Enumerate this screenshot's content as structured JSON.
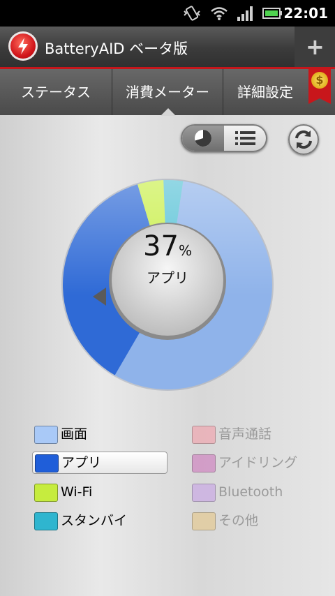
{
  "status_bar": {
    "time": "22:01",
    "icons": [
      "vibrate-icon",
      "wifi-icon",
      "signal-icon",
      "battery-icon"
    ]
  },
  "app_bar": {
    "title": "BatteryAID ベータ版",
    "logo_icon": "batteryaid-logo-icon",
    "add_icon": "plus-icon",
    "add_label": "+"
  },
  "tabs": [
    {
      "label": "ステータス",
      "selected": false
    },
    {
      "label": "消費メーター",
      "selected": true
    },
    {
      "label": "詳細設定",
      "selected": false
    }
  ],
  "premium_badge": {
    "icon": "dollar-coin-icon",
    "label": "$"
  },
  "view_toggle": {
    "options": [
      "pie-chart-icon",
      "list-icon"
    ],
    "selected": "pie-chart-icon"
  },
  "refresh_icon": "refresh-icon",
  "meter": {
    "selected_percent": "37",
    "percent_sign": "%",
    "selected_name": "アプリ"
  },
  "chart_data": {
    "type": "pie",
    "categories": [
      "画面",
      "アプリ",
      "Wi-Fi",
      "スタンバイ"
    ],
    "values": [
      56,
      37,
      4,
      3
    ],
    "colors": [
      "#8fb3ea",
      "#2f6ad6",
      "#c9ef4a",
      "#58c2d6"
    ],
    "highlighted": "アプリ"
  },
  "legend": [
    {
      "label": "画面",
      "color": "#a9c9f7",
      "active": false,
      "dim": false
    },
    {
      "label": "アプリ",
      "color": "#1f5ed9",
      "active": true,
      "dim": false
    },
    {
      "label": "Wi-Fi",
      "color": "#c6ec3e",
      "active": false,
      "dim": false
    },
    {
      "label": "スタンバイ",
      "color": "#2fb5cf",
      "active": false,
      "dim": false
    },
    {
      "label": "音声通話",
      "color": "#f2a3ad",
      "active": false,
      "dim": true
    },
    {
      "label": "アイドリング",
      "color": "#cf7fbf",
      "active": false,
      "dim": true
    },
    {
      "label": "Bluetooth",
      "color": "#c9a6e6",
      "active": false,
      "dim": true
    },
    {
      "label": "その他",
      "color": "#e6c98d",
      "active": false,
      "dim": true
    }
  ]
}
